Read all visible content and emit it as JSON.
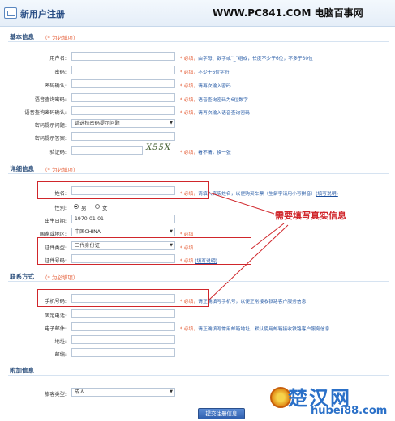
{
  "header": {
    "title": "新用户注册",
    "site": "WWW.PC841.COM 电脑百事网"
  },
  "basic": {
    "section_title": "基本信息",
    "required_note": "（* 为必填项）",
    "fields": [
      {
        "label": "用户名:",
        "hint_star": "* 必填，",
        "hint": "由字母、数字或“_”组成，长度不少于6位，不多于30位"
      },
      {
        "label": "密码:",
        "hint_star": "* 必填，",
        "hint": "不少于6位字符"
      },
      {
        "label": "密码确认:",
        "hint_star": "* 必填，",
        "hint": "请再次输入密码"
      },
      {
        "label": "语音查询密码:",
        "hint_star": "* 必填，",
        "hint": "语音查询密码为6位数字"
      },
      {
        "label": "语音查询密码确认:",
        "hint_star": "* 必填，",
        "hint": "请再次输入语音查询密码"
      }
    ],
    "pwd_question": {
      "label": "密码提示问题:",
      "selected": "请选择密码提示问题"
    },
    "pwd_answer": {
      "label": "密码提示答案:"
    },
    "captcha": {
      "label": "验证码:",
      "image_text": "X55X",
      "hint_star": "* 必填，",
      "link": "看不清，换一张"
    }
  },
  "detail": {
    "section_title": "详细信息",
    "required_note": "（* 为必填项）",
    "name": {
      "label": "姓名:",
      "hint_star": "* 必填，",
      "hint": "请填入真实姓名，以便购买车票（生僻字请用小写拼音）",
      "link": "(填写说明)"
    },
    "gender": {
      "label": "性别:",
      "male": "男",
      "female": "女"
    },
    "birthday": {
      "label": "出生日期:",
      "value": "1970-01-01"
    },
    "country": {
      "label": "国家或地区:",
      "selected": "中国CHINA",
      "hint_star": "* 必填"
    },
    "id_type": {
      "label": "证件类型:",
      "selected": "二代身份证",
      "hint_star": "* 必填"
    },
    "id_number": {
      "label": "证件号码:",
      "hint_star": "* 必填",
      "link": "(填写说明)"
    },
    "callout": "需要填写真实信息"
  },
  "contact": {
    "section_title": "联系方式",
    "required_note": "（* 为必填项）",
    "mobile": {
      "label": "手机号码:",
      "hint_star": "* 必填，",
      "hint": "请正确填写手机号，以便正常接收铁路客户服务信息"
    },
    "phone": {
      "label": "固定电话:"
    },
    "email": {
      "label": "电子邮件:",
      "hint_star": "* 必填，",
      "hint": "请正确填写常用邮箱地址，默认使用邮箱接收铁路客户服务信息"
    },
    "address": {
      "label": "地址:"
    },
    "zip": {
      "label": "邮编:"
    }
  },
  "extra": {
    "section_title": "附加信息",
    "passenger_type": {
      "label": "旅客类型:",
      "selected": "成人"
    }
  },
  "submit_label": "提交注册信息",
  "watermark": {
    "name": "楚汉网",
    "url": "hubei88.com"
  },
  "colors": {
    "accent": "#2c4f7c",
    "required": "#e45a33",
    "highlight": "#d0262b",
    "link": "#1a4f9e"
  }
}
